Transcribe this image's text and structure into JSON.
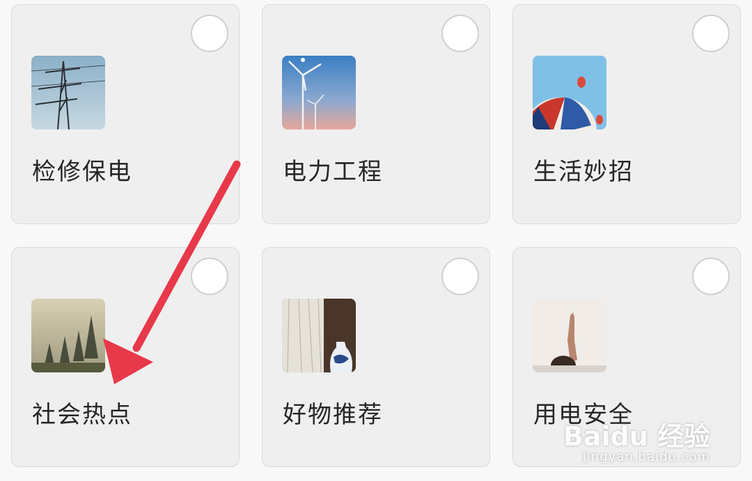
{
  "categories": [
    {
      "label": "检修保电",
      "image": "power-tower"
    },
    {
      "label": "电力工程",
      "image": "wind-turbine"
    },
    {
      "label": "生活妙招",
      "image": "hot-air-balloon"
    },
    {
      "label": "社会热点",
      "image": "misty-forest"
    },
    {
      "label": "好物推荐",
      "image": "vase-curtain"
    },
    {
      "label": "用电安全",
      "image": "raised-hand"
    }
  ],
  "annotation": {
    "arrow_color": "#e8394a",
    "target": "社会热点"
  },
  "watermark": {
    "brand": "Baidu 经验",
    "url": "jingyan.baidu.com"
  }
}
